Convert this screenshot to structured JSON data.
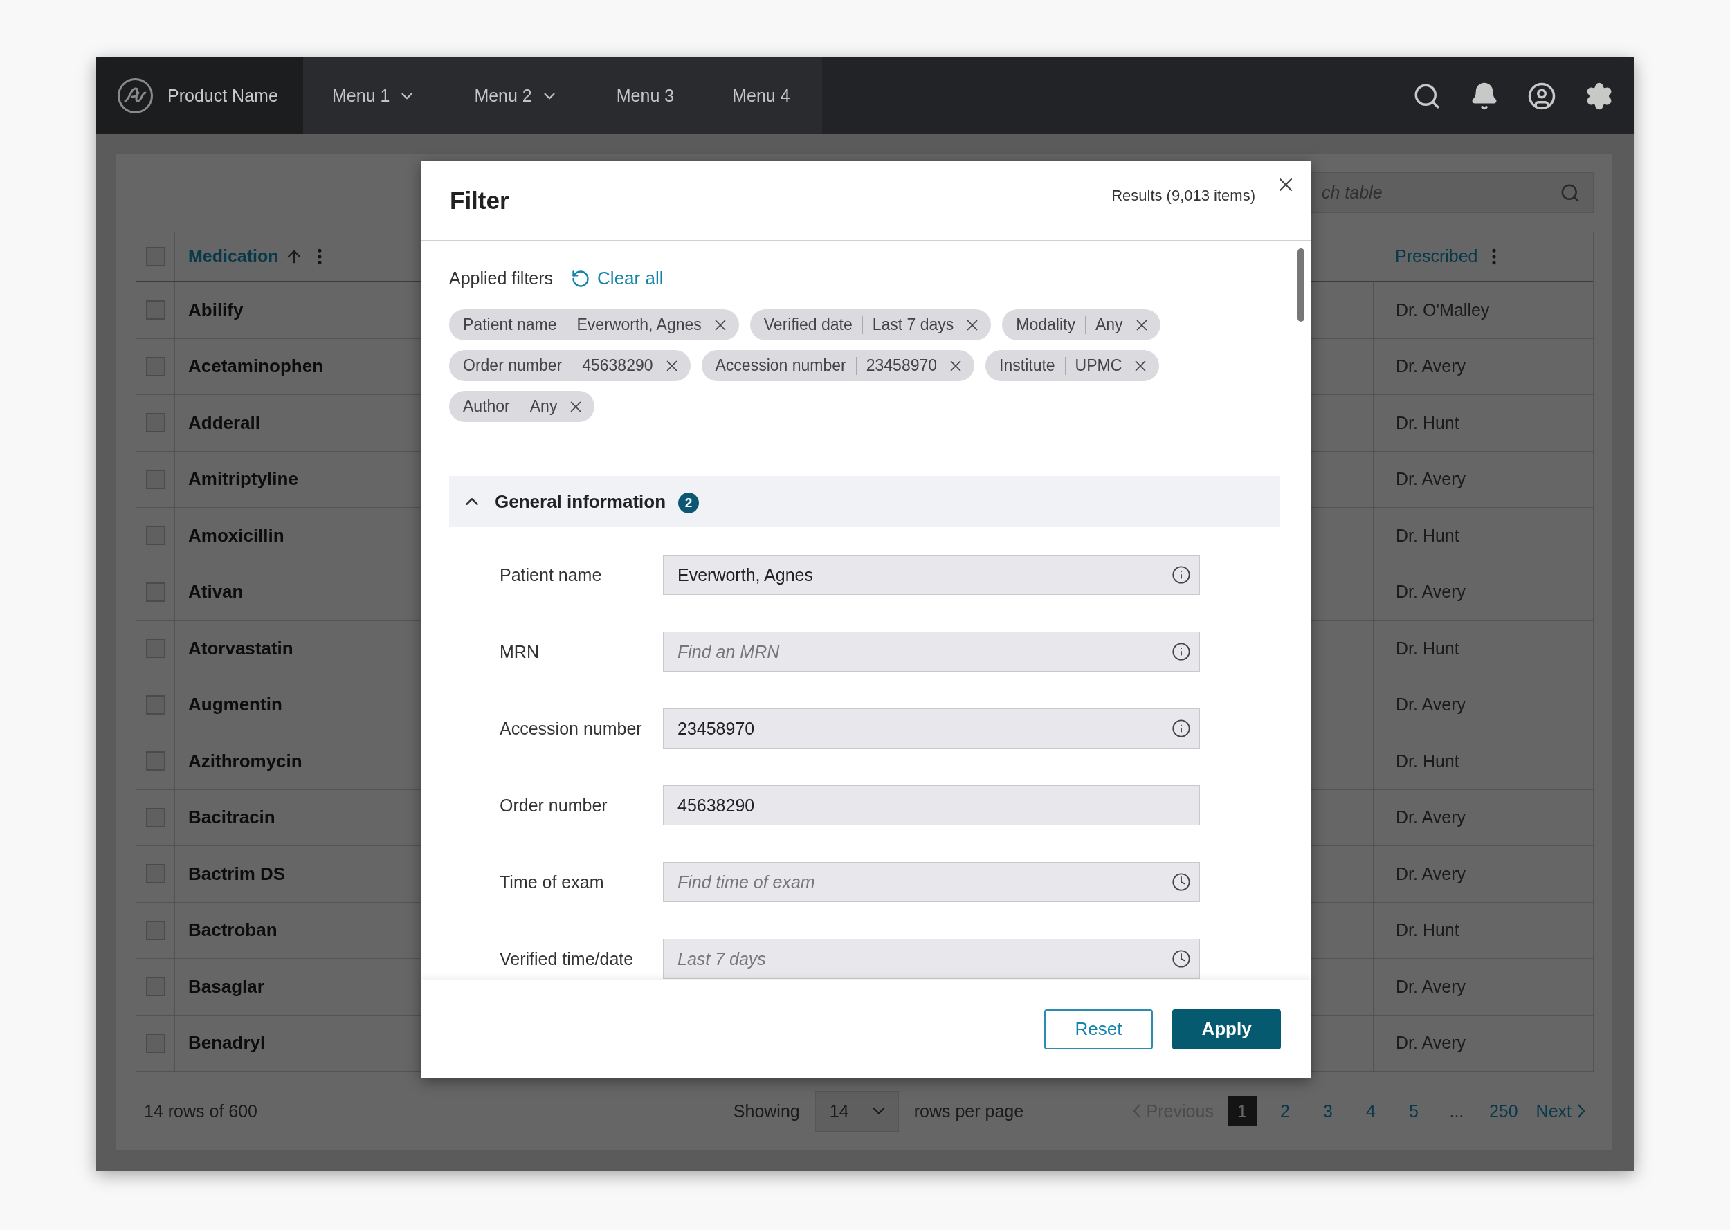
{
  "topbar": {
    "product_name": "Product Name",
    "menus": [
      {
        "label": "Menu 1",
        "dropdown": true
      },
      {
        "label": "Menu 2",
        "dropdown": true
      },
      {
        "label": "Menu 3",
        "dropdown": false
      },
      {
        "label": "Menu 4",
        "dropdown": false
      }
    ]
  },
  "table": {
    "search_placeholder": "ch table",
    "select_all": {
      "checked": false
    },
    "columns": [
      {
        "label": "Medication",
        "sorted": true
      },
      {
        "label": "Prescribed",
        "sorted": false
      }
    ],
    "rows": [
      {
        "checked": false,
        "medication": "Abilify",
        "prescribed": "Dr. O'Malley"
      },
      {
        "checked": false,
        "medication": "Acetaminophen",
        "prescribed": "Dr. Avery"
      },
      {
        "checked": false,
        "medication": "Adderall",
        "prescribed": "Dr. Hunt"
      },
      {
        "checked": false,
        "medication": "Amitriptyline",
        "prescribed": "Dr. Avery"
      },
      {
        "checked": false,
        "medication": "Amoxicillin",
        "prescribed": "Dr. Hunt"
      },
      {
        "checked": false,
        "medication": "Ativan",
        "prescribed": "Dr. Avery"
      },
      {
        "checked": false,
        "medication": "Atorvastatin",
        "prescribed": "Dr. Hunt"
      },
      {
        "checked": false,
        "medication": "Augmentin",
        "prescribed": "Dr. Avery"
      },
      {
        "checked": false,
        "medication": "Azithromycin",
        "prescribed": "Dr. Hunt"
      },
      {
        "checked": false,
        "medication": "Bacitracin",
        "prescribed": "Dr. Avery"
      },
      {
        "checked": false,
        "medication": "Bactrim DS",
        "prescribed": "Dr. Avery"
      },
      {
        "checked": false,
        "medication": "Bactroban",
        "prescribed": "Dr. Hunt"
      },
      {
        "checked": false,
        "medication": "Basaglar",
        "prescribed": "Dr. Avery"
      },
      {
        "checked": false,
        "medication": "Benadryl",
        "prescribed": "Dr. Avery"
      }
    ]
  },
  "pagination": {
    "summary": "14 rows of 600",
    "showing_label": "Showing",
    "rows_per_page": "14",
    "rows_per_page_label": "rows per page",
    "previous": {
      "label": "Previous",
      "disabled": true
    },
    "pages": [
      {
        "kind": "page",
        "label": "1",
        "selected": true
      },
      {
        "kind": "page",
        "label": "2",
        "selected": false
      },
      {
        "kind": "page",
        "label": "3",
        "selected": false
      },
      {
        "kind": "page",
        "label": "4",
        "selected": false
      },
      {
        "kind": "page",
        "label": "5",
        "selected": false
      },
      {
        "kind": "ellipsis",
        "label": "...",
        "selected": false
      },
      {
        "kind": "page",
        "label": "250",
        "selected": false
      }
    ],
    "next": {
      "label": "Next",
      "disabled": false
    }
  },
  "filter_dialog": {
    "title": "Filter",
    "results": "Results (9,013 items)",
    "applied_filters_label": "Applied filters",
    "clear_all": "Clear all",
    "chips": [
      {
        "name": "Patient name",
        "value": "Everworth, Agnes"
      },
      {
        "name": "Verified date",
        "value": "Last 7 days"
      },
      {
        "name": "Modality",
        "value": "Any"
      },
      {
        "name": "Order number",
        "value": "45638290"
      },
      {
        "name": "Accession number",
        "value": "23458970"
      },
      {
        "name": "Institute",
        "value": "UPMC"
      },
      {
        "name": "Author",
        "value": "Any"
      }
    ],
    "section": {
      "title": "General information",
      "count": "2",
      "expanded": true,
      "fields": [
        {
          "label": "Patient name",
          "value": "Everworth, Agnes",
          "kind": "info"
        },
        {
          "label": "MRN",
          "placeholder": "Find an MRN",
          "kind": "info"
        },
        {
          "label": "Accession number",
          "value": "23458970",
          "kind": "info"
        },
        {
          "label": "Order number",
          "value": "45638290",
          "kind": "plain"
        },
        {
          "label": "Time of exam",
          "placeholder": "Find time of exam",
          "kind": "clock"
        },
        {
          "label": "Verified time/date",
          "placeholder": "Last 7 days",
          "kind": "clock"
        }
      ]
    },
    "buttons": {
      "reset": "Reset",
      "apply": "Apply"
    }
  }
}
